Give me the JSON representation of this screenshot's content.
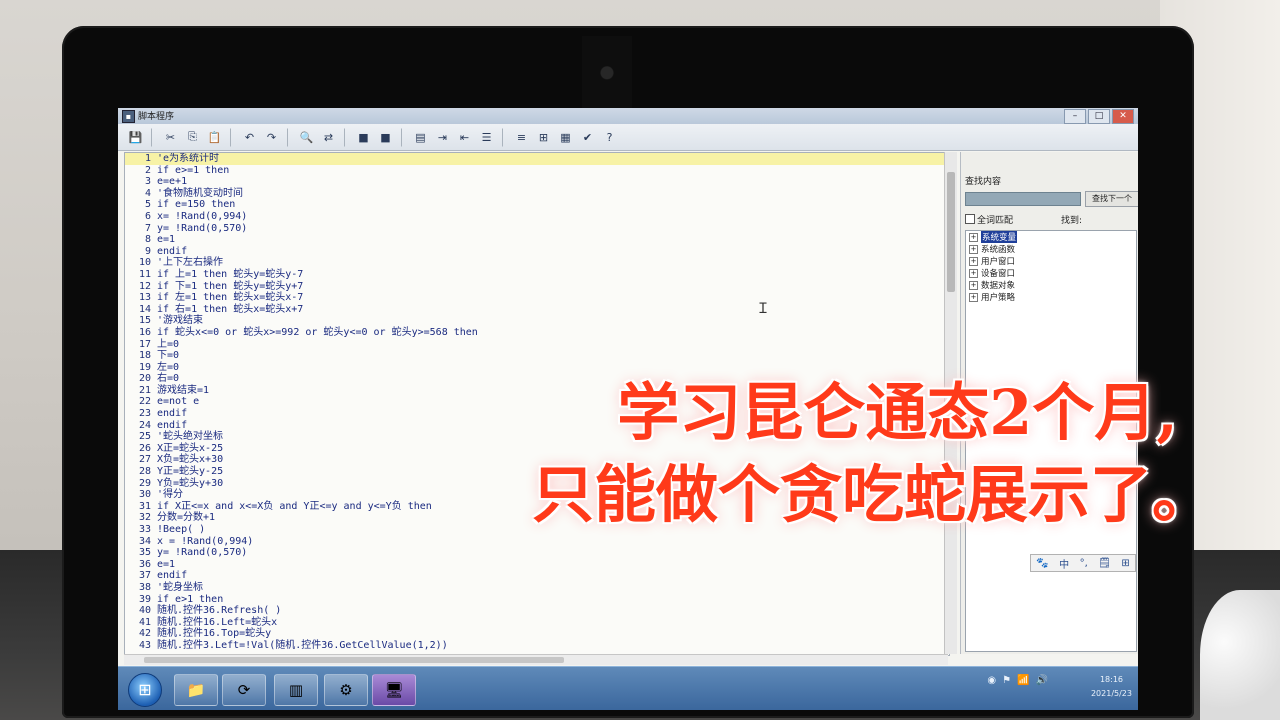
{
  "window": {
    "title": "脚本程序",
    "controls": [
      "–",
      "□",
      "✕"
    ]
  },
  "toolbar": {
    "icons": [
      "save-icon",
      "cut-icon",
      "copy-icon",
      "paste-icon",
      "undo-icon",
      "redo-icon",
      "find-icon",
      "replace-icon",
      "bookmark-icon",
      "bookmark-next-icon",
      "comment-icon",
      "indent-icon",
      "outdent-icon",
      "align-icon",
      "tree-icon",
      "list-icon",
      "table-icon",
      "check-icon",
      "help-icon"
    ],
    "glyphs": [
      "💾",
      "✂",
      "⎘",
      "📋",
      "↶",
      "↷",
      "🔍",
      "⇄",
      "■",
      "■",
      "▤",
      "⇥",
      "⇤",
      "☰",
      "≡",
      "⊞",
      "▦",
      "✔",
      "?"
    ]
  },
  "editor": {
    "lines": [
      {
        "n": "1",
        "t": "'e为系统计时"
      },
      {
        "n": "2",
        "t": "if e>=1 then"
      },
      {
        "n": "3",
        "t": "e=e+1"
      },
      {
        "n": "4",
        "t": "'食物随机变动时间"
      },
      {
        "n": "5",
        "t": "if e=150 then"
      },
      {
        "n": "6",
        "t": "x= !Rand(0,994)"
      },
      {
        "n": "7",
        "t": "y= !Rand(0,570)"
      },
      {
        "n": "8",
        "t": "e=1"
      },
      {
        "n": "9",
        "t": "endif"
      },
      {
        "n": "10",
        "t": "'上下左右操作"
      },
      {
        "n": "11",
        "t": "if 上=1 then 蛇头y=蛇头y-7"
      },
      {
        "n": "12",
        "t": "if 下=1 then 蛇头y=蛇头y+7"
      },
      {
        "n": "13",
        "t": "if 左=1 then 蛇头x=蛇头x-7"
      },
      {
        "n": "14",
        "t": "if 右=1 then 蛇头x=蛇头x+7"
      },
      {
        "n": "15",
        "t": "'游戏结束"
      },
      {
        "n": "16",
        "t": "if 蛇头x<=0 or 蛇头x>=992 or 蛇头y<=0 or 蛇头y>=568 then"
      },
      {
        "n": "17",
        "t": "上=0"
      },
      {
        "n": "18",
        "t": "下=0"
      },
      {
        "n": "19",
        "t": "左=0"
      },
      {
        "n": "20",
        "t": "右=0"
      },
      {
        "n": "21",
        "t": "游戏结束=1"
      },
      {
        "n": "22",
        "t": "e=not e"
      },
      {
        "n": "23",
        "t": "endif"
      },
      {
        "n": "24",
        "t": "endif"
      },
      {
        "n": "25",
        "t": "'蛇头绝对坐标"
      },
      {
        "n": "26",
        "t": "X正=蛇头x-25"
      },
      {
        "n": "27",
        "t": "X负=蛇头x+30"
      },
      {
        "n": "28",
        "t": "Y正=蛇头y-25"
      },
      {
        "n": "29",
        "t": "Y负=蛇头y+30"
      },
      {
        "n": "30",
        "t": "'得分"
      },
      {
        "n": "31",
        "t": "if X正<=x and x<=X负 and Y正<=y and y<=Y负 then"
      },
      {
        "n": "32",
        "t": "分数=分数+1"
      },
      {
        "n": "33",
        "t": "!Beep( )"
      },
      {
        "n": "34",
        "t": "x = !Rand(0,994)"
      },
      {
        "n": "35",
        "t": "y= !Rand(0,570)"
      },
      {
        "n": "36",
        "t": "e=1"
      },
      {
        "n": "37",
        "t": "endif"
      },
      {
        "n": "38",
        "t": "'蛇身坐标"
      },
      {
        "n": "39",
        "t": "if e>1 then"
      },
      {
        "n": "40",
        "t": "随机.控件36.Refresh( )"
      },
      {
        "n": "41",
        "t": "随机.控件16.Left=蛇头x"
      },
      {
        "n": "42",
        "t": "随机.控件16.Top=蛇头y"
      },
      {
        "n": "43",
        "t": "随机.控件3.Left=!Val(随机.控件36.GetCellValue(1,2))"
      }
    ]
  },
  "panel": {
    "find_label": "查找内容",
    "find_button": "查找下一个",
    "match_label": "全词匹配",
    "found_label": "找到:",
    "tree": [
      {
        "label": "系统变量",
        "selected": true
      },
      {
        "label": "系统函数",
        "selected": false
      },
      {
        "label": "用户窗口",
        "selected": false
      },
      {
        "label": "设备窗口",
        "selected": false
      },
      {
        "label": "数据对象",
        "selected": false
      },
      {
        "label": "用户策略",
        "selected": false
      }
    ]
  },
  "ime": [
    "🐾",
    "中",
    "°,",
    "🗒",
    "⊞"
  ],
  "taskbar": {
    "start_glyph": "⊞",
    "buttons": [
      "📁",
      "⟳",
      "▥",
      "⚙",
      "🖥"
    ],
    "tray": [
      "◉",
      "⚑",
      "📶",
      "🔊"
    ],
    "time": "18:16",
    "date": "2021/5/23"
  },
  "overlay": {
    "line1": "学习昆仑通态2个月,",
    "line2": "只能做个贪吃蛇展示了。"
  }
}
